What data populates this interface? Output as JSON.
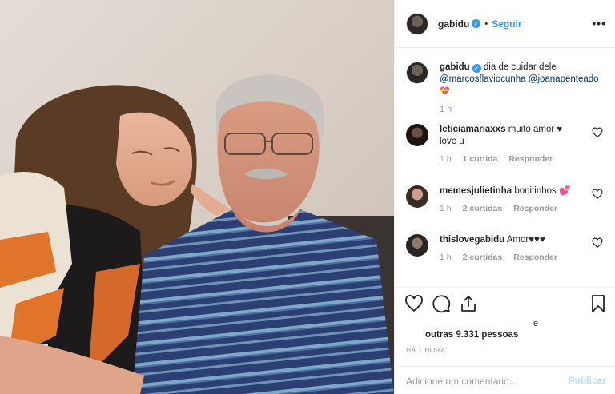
{
  "post": {
    "username": "gabidu",
    "verified_mark": "✓",
    "dot": "•",
    "follow_label": "Seguir",
    "more_label": "•••"
  },
  "caption": {
    "username": "gabidu",
    "text": "dia de cuidar dele",
    "mentions": [
      "@marcosflaviocunha",
      "@joanapenteado"
    ],
    "emoji": "💝",
    "time": "1 h"
  },
  "comments": [
    {
      "username": "leticiamariaxxs",
      "text": "muito amor ♥ love u",
      "time": "1 h",
      "likes": "1 curtida",
      "reply": "Responder"
    },
    {
      "username": "memesjulietinha",
      "text": "bonitinhos 💕",
      "time": "1 h",
      "likes": "2 curtidas",
      "reply": "Responder"
    },
    {
      "username": "thislovegabidu",
      "text": "Amor♥♥♥",
      "time": "1 h",
      "likes": "2 curtidas",
      "reply": "Responder"
    }
  ],
  "likes": {
    "prefix": "e",
    "text": "outras 9.331 pessoas"
  },
  "timestamp": "HÁ 1 HORA",
  "add_comment": {
    "placeholder": "Adicione um comentário...",
    "publish_label": "Publicar"
  },
  "icons": {
    "like": "heart-icon",
    "comment": "comment-icon",
    "share": "share-icon",
    "save": "bookmark-icon"
  }
}
